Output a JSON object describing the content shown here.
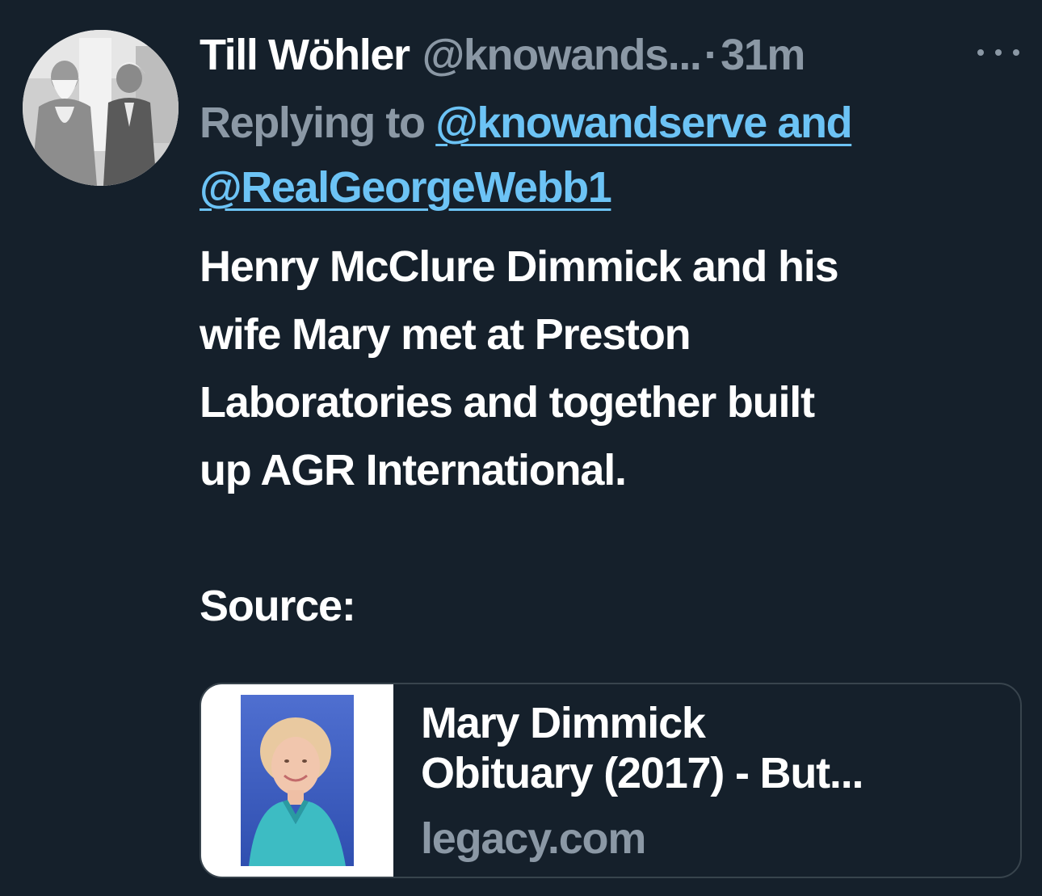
{
  "author": {
    "name": "Till Wöhler",
    "handle": "@knowands...",
    "separator": "·",
    "time": "31m"
  },
  "more_icon": "ellipsis-icon",
  "reply": {
    "prefix": "Replying to",
    "link1": "@knowandserve and",
    "link2": "@RealGeorgeWebb1"
  },
  "body": {
    "line1": "Henry McClure Dimmick and his",
    "line2": "wife Mary met at Preston",
    "line3": "Laboratories and together built",
    "line4": "up AGR International.",
    "source_label": "Source:"
  },
  "link_card": {
    "title_line1": "Mary Dimmick",
    "title_line2": "Obituary (2017) - But...",
    "domain": "legacy.com"
  },
  "colors": {
    "background": "#15202b",
    "text": "#ffffff",
    "secondary": "#8b98a5",
    "link": "#6cc3f5",
    "border": "#38444d"
  }
}
